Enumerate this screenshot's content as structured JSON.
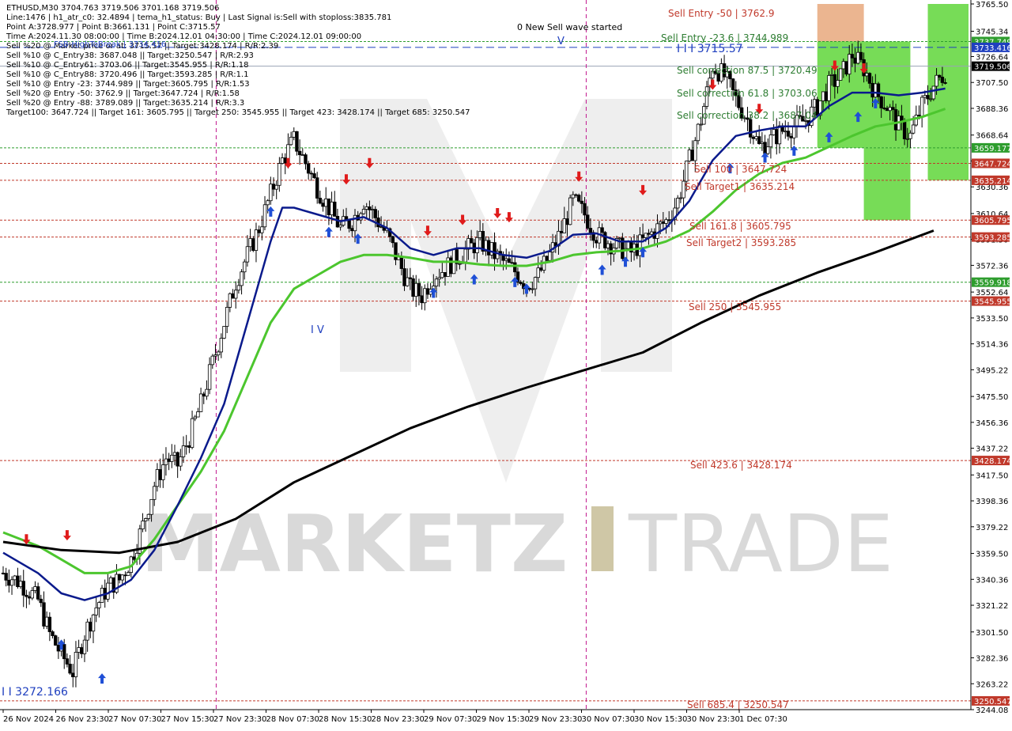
{
  "info_panel": {
    "lines": [
      "ETHUSD,M30  3704.763 3719.506 3701.168 3719.506",
      "Line:1476 | h1_atr_c0: 32.4894 | tema_h1_status: Buy | Last Signal is:Sell with stoploss:3835.781",
      "Point A:3728.977 | Point B:3661.131 | Point C:3715.57",
      "Time A:2024.11.30 08:00:00 | Time B:2024.12.01 04:30:00 | Time C:2024.12.01 09:00:00",
      "Sell %20 @ Market price or at: 3715.57 || Target:3428.174 | R/R:2.39",
      "Sell %10 @ C_Entry38: 3687.048 || Target:3250.547 | R/R:2.93",
      "Sell %10 @ C_Entry61: 3703.06 || Target:3545.955 | R/R:1.18",
      "Sell %10 @ C_Entry88: 3720.496 || Target:3593.285 | R/R:1.1",
      "Sell %10 @ Entry -23: 3744.989 || Target:3605.795 | R/R:1.53",
      "Sell %20 @ Entry -50: 3762.9 || Target:3647.724 | R/R:1.58",
      "Sell %20 @ Entry -88: 3789.089 || Target:3635.214 | R/R:3.3",
      "Target100: 3647.724 || Target 161: 3605.795 || Target 250: 3545.955 || Target 423: 3428.174 || Target 685: 3250.547"
    ],
    "fsb_label": "FSB-HighToBreak | 3734.416"
  },
  "annotations": {
    "new_wave": "0 New Sell wave started",
    "wave_mark_top": "V",
    "wave_mark_mid": "I V",
    "low_label": "I I 3272.166",
    "c_label": "I I I 3715.57",
    "levels": [
      {
        "text": "Sell Entry -50 | 3762.9",
        "color": "#c0392b"
      },
      {
        "text": "Sell Entry -23.6 | 3744.989",
        "color": "#2e7d32"
      },
      {
        "text": "Sell correction 87.5 | 3720.49",
        "color": "#2e7d32"
      },
      {
        "text": "Sell correction 61.8 | 3703.06",
        "color": "#2e7d32"
      },
      {
        "text": "Sell correction 38.2 | 3687.04",
        "color": "#2e7d32"
      },
      {
        "text": "Sell 100 | 3647.724",
        "color": "#c0392b"
      },
      {
        "text": "Sell Target1 | 3635.214",
        "color": "#c0392b"
      },
      {
        "text": "Sell 161.8 | 3605.795",
        "color": "#c0392b"
      },
      {
        "text": "Sell Target2 | 3593.285",
        "color": "#c0392b"
      },
      {
        "text": "Sell 250 | 3545.955",
        "color": "#c0392b"
      },
      {
        "text": "Sell 423.6 | 3428.174",
        "color": "#c0392b"
      },
      {
        "text": "Sell 685.4 | 3250.547",
        "color": "#c0392b"
      }
    ]
  },
  "watermark": {
    "left": "MARKETZ",
    "right": "TRADE"
  },
  "colors": {
    "background": "#ffffff",
    "bull_candle": "#ffffff",
    "bear_candle": "#000000",
    "ma_black": "#000000",
    "ma_navy": "#0a1a8c",
    "ma_green": "#4cc62e",
    "ma_red": "#c81e1e",
    "buy_arrow": "#1f4fd6",
    "sell_arrow": "#e01b1b",
    "level_red": "#c0392b",
    "level_green": "#2e7d32",
    "zone_orange": "#e8a87c",
    "zone_green": "#5fd63a",
    "current_price_tag": "#000000"
  },
  "chart_data": {
    "type": "candlestick",
    "symbol": "ETHUSD",
    "timeframe": "M30",
    "ohlc_last": {
      "open": 3704.763,
      "high": 3719.506,
      "low": 3701.168,
      "close": 3719.506
    },
    "x_tick_labels": [
      "26 Nov 2024",
      "26 Nov 23:30",
      "27 Nov 07:30",
      "27 Nov 15:30",
      "27 Nov 23:30",
      "28 Nov 07:30",
      "28 Nov 15:30",
      "28 Nov 23:30",
      "29 Nov 07:30",
      "29 Nov 15:30",
      "29 Nov 23:30",
      "30 Nov 07:30",
      "30 Nov 15:30",
      "30 Nov 23:30",
      "1 Dec 07:30"
    ],
    "y_ticks": [
      3765.5,
      3745.34,
      3726.64,
      3707.5,
      3688.36,
      3668.64,
      3649.5,
      3630.36,
      3610.64,
      3591.5,
      3572.36,
      3552.64,
      3533.5,
      3514.36,
      3495.22,
      3475.5,
      3456.36,
      3437.22,
      3417.5,
      3398.36,
      3379.22,
      3359.5,
      3340.36,
      3321.22,
      3301.5,
      3282.36,
      3263.22,
      3244.08
    ],
    "ylim": [
      3244.08,
      3765.5
    ],
    "price_tags": [
      {
        "value": 3737.749,
        "label": "3737.749",
        "color": "#2e9d2e"
      },
      {
        "value": 3733.416,
        "label": "3733.416",
        "color": "#1f3fbf"
      },
      {
        "value": 3719.506,
        "label": "3719.506",
        "color": "#000000"
      },
      {
        "value": 3659.177,
        "label": "3659.177",
        "color": "#2e9d2e"
      },
      {
        "value": 3647.724,
        "label": "3647.724",
        "color": "#c0392b"
      },
      {
        "value": 3635.214,
        "label": "3635.214",
        "color": "#c0392b"
      },
      {
        "value": 3605.795,
        "label": "3605.795",
        "color": "#c0392b"
      },
      {
        "value": 3593.285,
        "label": "3593.285",
        "color": "#c0392b"
      },
      {
        "value": 3559.918,
        "label": "3559.918",
        "color": "#2e9d2e"
      },
      {
        "value": 3545.955,
        "label": "3545.955",
        "color": "#c0392b"
      },
      {
        "value": 3428.174,
        "label": "3428.174",
        "color": "#c0392b"
      },
      {
        "value": 3250.547,
        "label": "3250.547",
        "color": "#c0392b"
      }
    ],
    "horizontal_levels": [
      {
        "value": 3737.749,
        "style": "dotted",
        "color": "#2e9d2e"
      },
      {
        "value": 3733.416,
        "style": "dashed",
        "color": "#1f3fbf"
      },
      {
        "value": 3719.506,
        "style": "solid",
        "color": "#9aa3b5"
      },
      {
        "value": 3659.177,
        "style": "dotted",
        "color": "#2e9d2e"
      },
      {
        "value": 3647.724,
        "style": "dotted",
        "color": "#c0392b"
      },
      {
        "value": 3635.214,
        "style": "dotted",
        "color": "#c0392b"
      },
      {
        "value": 3605.795,
        "style": "dotted",
        "color": "#c0392b"
      },
      {
        "value": 3593.285,
        "style": "dotted",
        "color": "#c0392b"
      },
      {
        "value": 3559.918,
        "style": "dotted",
        "color": "#2e9d2e"
      },
      {
        "value": 3545.955,
        "style": "dotted",
        "color": "#c0392b"
      },
      {
        "value": 3428.174,
        "style": "dotted",
        "color": "#c0392b"
      },
      {
        "value": 3250.547,
        "style": "dotted",
        "color": "#c0392b"
      }
    ],
    "vertical_markers": [
      "27 Nov 23:30",
      "30 Nov 07:30"
    ],
    "price_path": [
      [
        0,
        3345
      ],
      [
        3,
        3338
      ],
      [
        6,
        3325
      ],
      [
        8,
        3300
      ],
      [
        10,
        3285
      ],
      [
        12,
        3272
      ],
      [
        14,
        3300
      ],
      [
        16,
        3320
      ],
      [
        18,
        3335
      ],
      [
        20,
        3340
      ],
      [
        22,
        3355
      ],
      [
        24,
        3380
      ],
      [
        26,
        3410
      ],
      [
        28,
        3430
      ],
      [
        30,
        3425
      ],
      [
        32,
        3445
      ],
      [
        34,
        3470
      ],
      [
        36,
        3500
      ],
      [
        38,
        3530
      ],
      [
        40,
        3560
      ],
      [
        42,
        3580
      ],
      [
        44,
        3600
      ],
      [
        46,
        3625
      ],
      [
        48,
        3650
      ],
      [
        50,
        3665
      ],
      [
        52,
        3648
      ],
      [
        54,
        3630
      ],
      [
        56,
        3615
      ],
      [
        58,
        3600
      ],
      [
        60,
        3605
      ],
      [
        62,
        3620
      ],
      [
        64,
        3608
      ],
      [
        66,
        3595
      ],
      [
        68,
        3575
      ],
      [
        70,
        3555
      ],
      [
        72,
        3550
      ],
      [
        74,
        3565
      ],
      [
        76,
        3570
      ],
      [
        78,
        3578
      ],
      [
        80,
        3585
      ],
      [
        82,
        3590
      ],
      [
        84,
        3582
      ],
      [
        86,
        3575
      ],
      [
        88,
        3568
      ],
      [
        90,
        3558
      ],
      [
        92,
        3565
      ],
      [
        94,
        3580
      ],
      [
        96,
        3598
      ],
      [
        98,
        3620
      ],
      [
        100,
        3610
      ],
      [
        102,
        3595
      ],
      [
        104,
        3590
      ],
      [
        106,
        3585
      ],
      [
        108,
        3582
      ],
      [
        110,
        3590
      ],
      [
        112,
        3598
      ],
      [
        114,
        3605
      ],
      [
        116,
        3620
      ],
      [
        118,
        3650
      ],
      [
        120,
        3680
      ],
      [
        122,
        3720
      ],
      [
        124,
        3712
      ],
      [
        126,
        3695
      ],
      [
        128,
        3680
      ],
      [
        130,
        3660
      ],
      [
        132,
        3665
      ],
      [
        134,
        3672
      ],
      [
        136,
        3675
      ],
      [
        138,
        3680
      ],
      [
        140,
        3690
      ],
      [
        142,
        3705
      ],
      [
        144,
        3712
      ],
      [
        146,
        3728
      ],
      [
        148,
        3718
      ],
      [
        150,
        3700
      ],
      [
        152,
        3690
      ],
      [
        154,
        3675
      ],
      [
        156,
        3668
      ],
      [
        158,
        3690
      ],
      [
        160,
        3705
      ],
      [
        162,
        3715
      ]
    ],
    "ma_black": [
      [
        0,
        3368
      ],
      [
        10,
        3362
      ],
      [
        20,
        3360
      ],
      [
        30,
        3368
      ],
      [
        40,
        3385
      ],
      [
        50,
        3412
      ],
      [
        60,
        3432
      ],
      [
        70,
        3452
      ],
      [
        80,
        3468
      ],
      [
        90,
        3482
      ],
      [
        100,
        3495
      ],
      [
        110,
        3508
      ],
      [
        120,
        3530
      ],
      [
        130,
        3550
      ],
      [
        140,
        3567
      ],
      [
        150,
        3582
      ],
      [
        160,
        3598
      ]
    ],
    "ma_navy": [
      [
        0,
        3360
      ],
      [
        6,
        3345
      ],
      [
        10,
        3330
      ],
      [
        14,
        3325
      ],
      [
        18,
        3330
      ],
      [
        22,
        3340
      ],
      [
        26,
        3362
      ],
      [
        30,
        3395
      ],
      [
        34,
        3430
      ],
      [
        38,
        3470
      ],
      [
        42,
        3530
      ],
      [
        46,
        3590
      ],
      [
        48,
        3615
      ],
      [
        50,
        3615
      ],
      [
        54,
        3610
      ],
      [
        58,
        3605
      ],
      [
        62,
        3608
      ],
      [
        66,
        3600
      ],
      [
        70,
        3585
      ],
      [
        74,
        3580
      ],
      [
        78,
        3585
      ],
      [
        82,
        3585
      ],
      [
        86,
        3580
      ],
      [
        90,
        3578
      ],
      [
        94,
        3583
      ],
      [
        98,
        3595
      ],
      [
        102,
        3596
      ],
      [
        106,
        3590
      ],
      [
        110,
        3590
      ],
      [
        114,
        3600
      ],
      [
        118,
        3620
      ],
      [
        122,
        3650
      ],
      [
        126,
        3668
      ],
      [
        130,
        3672
      ],
      [
        134,
        3675
      ],
      [
        138,
        3675
      ],
      [
        142,
        3690
      ],
      [
        146,
        3700
      ],
      [
        150,
        3700
      ],
      [
        154,
        3698
      ],
      [
        158,
        3700
      ],
      [
        162,
        3703
      ]
    ],
    "ma_green": [
      [
        0,
        3375
      ],
      [
        6,
        3365
      ],
      [
        10,
        3355
      ],
      [
        14,
        3345
      ],
      [
        18,
        3345
      ],
      [
        22,
        3350
      ],
      [
        26,
        3370
      ],
      [
        30,
        3395
      ],
      [
        34,
        3420
      ],
      [
        38,
        3450
      ],
      [
        42,
        3490
      ],
      [
        46,
        3530
      ],
      [
        50,
        3555
      ],
      [
        54,
        3565
      ],
      [
        58,
        3575
      ],
      [
        62,
        3580
      ],
      [
        66,
        3580
      ],
      [
        70,
        3578
      ],
      [
        74,
        3575
      ],
      [
        78,
        3575
      ],
      [
        82,
        3573
      ],
      [
        86,
        3572
      ],
      [
        90,
        3572
      ],
      [
        94,
        3575
      ],
      [
        98,
        3580
      ],
      [
        102,
        3582
      ],
      [
        106,
        3583
      ],
      [
        110,
        3585
      ],
      [
        114,
        3590
      ],
      [
        118,
        3598
      ],
      [
        122,
        3612
      ],
      [
        126,
        3628
      ],
      [
        130,
        3640
      ],
      [
        134,
        3648
      ],
      [
        138,
        3652
      ],
      [
        142,
        3660
      ],
      [
        146,
        3668
      ],
      [
        150,
        3675
      ],
      [
        154,
        3678
      ],
      [
        158,
        3682
      ],
      [
        162,
        3688
      ]
    ],
    "buy_arrows": [
      [
        10,
        3300
      ],
      [
        17,
        3275
      ],
      [
        46,
        3620
      ],
      [
        56,
        3605
      ],
      [
        61,
        3600
      ],
      [
        74,
        3560
      ],
      [
        81,
        3570
      ],
      [
        88,
        3568
      ],
      [
        90,
        3563
      ],
      [
        103,
        3577
      ],
      [
        107,
        3583
      ],
      [
        110,
        3590
      ],
      [
        125,
        3652
      ],
      [
        131,
        3660
      ],
      [
        136,
        3665
      ],
      [
        142,
        3675
      ],
      [
        147,
        3690
      ],
      [
        150,
        3700
      ]
    ],
    "sell_arrows": [
      [
        4,
        3362
      ],
      [
        11,
        3365
      ],
      [
        49,
        3640
      ],
      [
        59,
        3628
      ],
      [
        63,
        3640
      ],
      [
        73,
        3590
      ],
      [
        79,
        3598
      ],
      [
        85,
        3603
      ],
      [
        87,
        3600
      ],
      [
        99,
        3630
      ],
      [
        110,
        3620
      ],
      [
        122,
        3698
      ],
      [
        130,
        3680
      ],
      [
        143,
        3712
      ],
      [
        148,
        3710
      ]
    ],
    "zones": [
      {
        "color": "#e8a87c",
        "x0": 140,
        "x1": 148,
        "y0": 3765.5,
        "y1": 3737.749
      },
      {
        "color": "#5fd63a",
        "x0": 140,
        "x1": 156,
        "y0": 3737.749,
        "y1": 3659.177
      },
      {
        "color": "#5fd63a",
        "x0": 148,
        "x1": 156,
        "y0": 3659.177,
        "y1": 3605.795
      },
      {
        "color": "#5fd63a",
        "x0": 159,
        "x1": 166,
        "y0": 3765.5,
        "y1": 3635.214
      }
    ],
    "x_range": [
      0,
      166
    ]
  }
}
